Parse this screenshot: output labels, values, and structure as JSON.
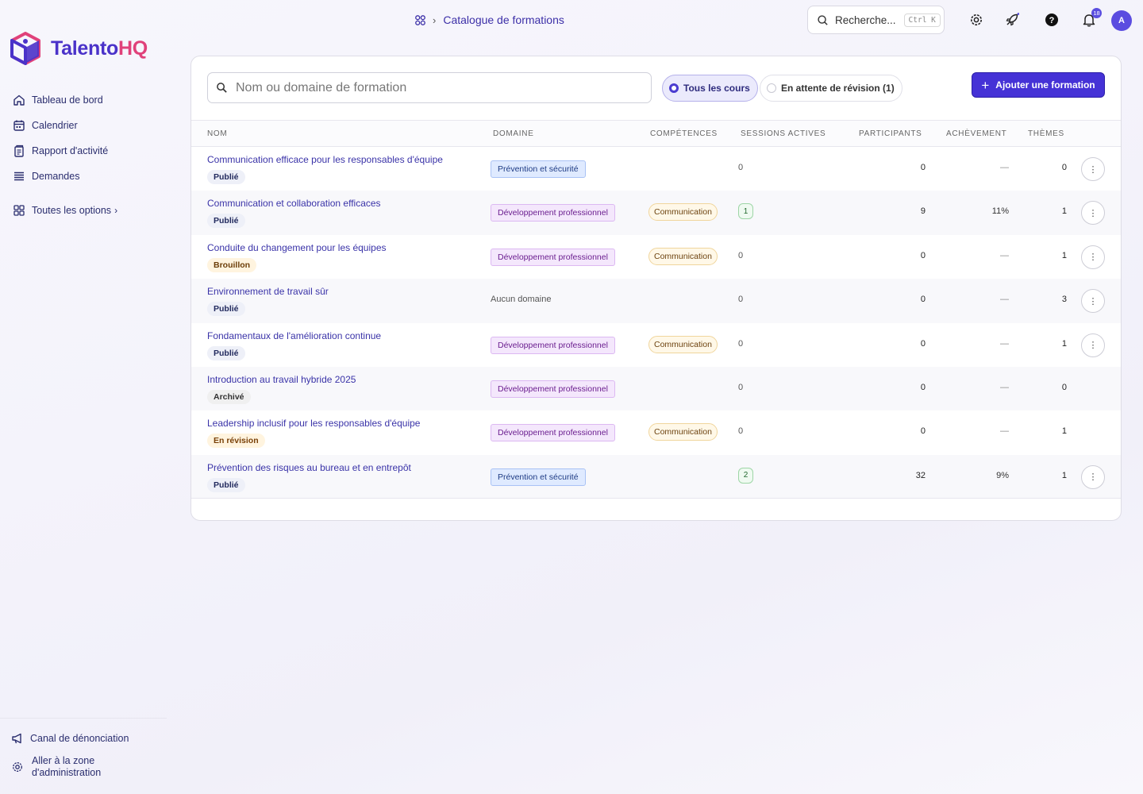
{
  "brand": {
    "name_a": "Talento",
    "name_b": "HQ"
  },
  "sidebar": {
    "items": [
      {
        "label": "Tableau de bord",
        "icon": "home-icon"
      },
      {
        "label": "Calendrier",
        "icon": "calendar-icon"
      },
      {
        "label": "Rapport d'activité",
        "icon": "report-icon"
      },
      {
        "label": "Demandes",
        "icon": "list-icon"
      }
    ],
    "more_label": "Toutes les options",
    "bottom": {
      "whistle_label": "Canal de dénonciation",
      "admin_label_1": "Aller à la zone",
      "admin_label_2": "d'administration"
    }
  },
  "header": {
    "breadcrumb": "Catalogue de formations",
    "search_placeholder": "Recherche...",
    "search_kbd": "Ctrl K",
    "notifications_count": "18",
    "avatar_initial": "A"
  },
  "toolbar": {
    "search_placeholder": "Nom ou domaine de formation",
    "filter_all": "Tous les cours",
    "filter_review": "En attente de révision (1)",
    "add_label": "Ajouter une formation"
  },
  "table": {
    "headers": {
      "name": "NOM",
      "domain": "DOMAINE",
      "skills": "COMPÉTENCES",
      "sessions": "SESSIONS ACTIVES",
      "participants": "PARTICIPANTS",
      "completion": "ACHÈVEMENT",
      "themes": "THÈMES"
    },
    "rows": [
      {
        "title": "Communication efficace pour les responsables d'équipe",
        "status": "Publié",
        "domain": "Prévention et sécurité",
        "skill": "",
        "sessions": "0",
        "participants": "0",
        "completion": "—",
        "themes": "0"
      },
      {
        "title": "Communication et collaboration efficaces",
        "status": "Publié",
        "domain": "Développement professionnel",
        "skill": "Communication",
        "sessions": "1",
        "participants": "9",
        "completion": "11%",
        "themes": "1"
      },
      {
        "title": "Conduite du changement pour les équipes",
        "status": "Brouillon",
        "domain": "Développement professionnel",
        "skill": "Communication",
        "sessions": "0",
        "participants": "0",
        "completion": "—",
        "themes": "1"
      },
      {
        "title": "Environnement de travail sûr",
        "status": "Publié",
        "domain": "Aucun domaine",
        "skill": "",
        "sessions": "0",
        "participants": "0",
        "completion": "—",
        "themes": "3"
      },
      {
        "title": "Fondamentaux de l'amélioration continue",
        "status": "Publié",
        "domain": "Développement professionnel",
        "skill": "Communication",
        "sessions": "0",
        "participants": "0",
        "completion": "—",
        "themes": "1"
      },
      {
        "title": "Introduction au travail hybride 2025",
        "status": "Archivé",
        "domain": "Développement professionnel",
        "skill": "",
        "sessions": "0",
        "participants": "0",
        "completion": "—",
        "themes": "0"
      },
      {
        "title": "Leadership inclusif pour les responsables d'équipe",
        "status": "En révision",
        "domain": "Développement professionnel",
        "skill": "Communication",
        "sessions": "0",
        "participants": "0",
        "completion": "—",
        "themes": "1"
      },
      {
        "title": "Prévention des risques au bureau et en entrepôt",
        "status": "Publié",
        "domain": "Prévention et sécurité",
        "skill": "",
        "sessions": "2",
        "participants": "32",
        "completion": "9%",
        "themes": "1"
      }
    ]
  }
}
